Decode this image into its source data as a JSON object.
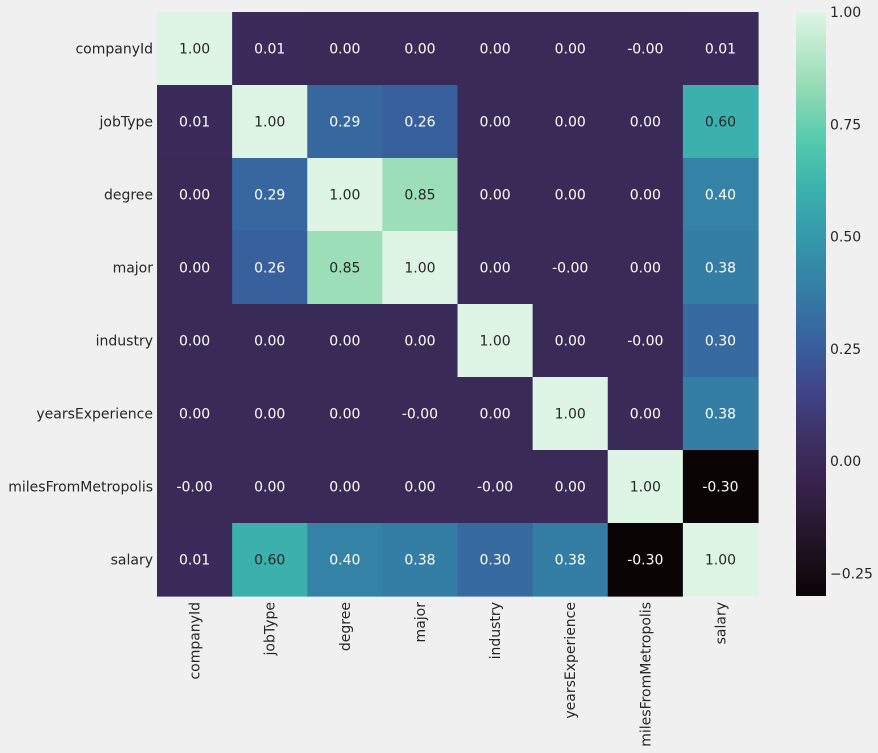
{
  "chart_data": {
    "type": "heatmap",
    "title": "",
    "xlabel": "",
    "ylabel": "",
    "x_labels": [
      "companyId",
      "jobType",
      "degree",
      "major",
      "industry",
      "yearsExperience",
      "milesFromMetropolis",
      "salary"
    ],
    "y_labels": [
      "companyId",
      "jobType",
      "degree",
      "major",
      "industry",
      "yearsExperience",
      "milesFromMetropolis",
      "salary"
    ],
    "values": [
      [
        1.0,
        0.01,
        0.0,
        0.0,
        0.0,
        0.0,
        -0.0,
        0.01
      ],
      [
        0.01,
        1.0,
        0.29,
        0.26,
        0.0,
        0.0,
        0.0,
        0.6
      ],
      [
        0.0,
        0.29,
        1.0,
        0.85,
        0.0,
        0.0,
        0.0,
        0.4
      ],
      [
        0.0,
        0.26,
        0.85,
        1.0,
        0.0,
        -0.0,
        0.0,
        0.38
      ],
      [
        0.0,
        0.0,
        0.0,
        0.0,
        1.0,
        0.0,
        -0.0,
        0.3
      ],
      [
        0.0,
        0.0,
        0.0,
        -0.0,
        0.0,
        1.0,
        0.0,
        0.38
      ],
      [
        -0.0,
        0.0,
        0.0,
        0.0,
        -0.0,
        0.0,
        1.0,
        -0.3
      ],
      [
        0.01,
        0.6,
        0.4,
        0.38,
        0.3,
        0.38,
        -0.3,
        1.0
      ]
    ],
    "annotations": [
      [
        "1.00",
        "0.01",
        "0.00",
        "0.00",
        "0.00",
        "0.00",
        "-0.00",
        "0.01"
      ],
      [
        "0.01",
        "1.00",
        "0.29",
        "0.26",
        "0.00",
        "0.00",
        "0.00",
        "0.60"
      ],
      [
        "0.00",
        "0.29",
        "1.00",
        "0.85",
        "0.00",
        "0.00",
        "0.00",
        "0.40"
      ],
      [
        "0.00",
        "0.26",
        "0.85",
        "1.00",
        "0.00",
        "-0.00",
        "0.00",
        "0.38"
      ],
      [
        "0.00",
        "0.00",
        "0.00",
        "0.00",
        "1.00",
        "0.00",
        "-0.00",
        "0.30"
      ],
      [
        "0.00",
        "0.00",
        "0.00",
        "-0.00",
        "0.00",
        "1.00",
        "0.00",
        "0.38"
      ],
      [
        "-0.00",
        "0.00",
        "0.00",
        "0.00",
        "-0.00",
        "0.00",
        "1.00",
        "-0.30"
      ],
      [
        "0.01",
        "0.60",
        "0.40",
        "0.38",
        "0.30",
        "0.38",
        "-0.30",
        "1.00"
      ]
    ],
    "colormap": "mako",
    "vmin": -0.3,
    "vmax": 1.0,
    "colorbar": {
      "ticks": [
        1.0,
        0.75,
        0.5,
        0.25,
        0.0,
        -0.25
      ],
      "tick_labels": [
        "1.00",
        "0.75",
        "0.50",
        "0.25",
        "0.00",
        "−0.25"
      ],
      "placement": "right"
    },
    "grid": false,
    "background": "#f0f0f0"
  }
}
